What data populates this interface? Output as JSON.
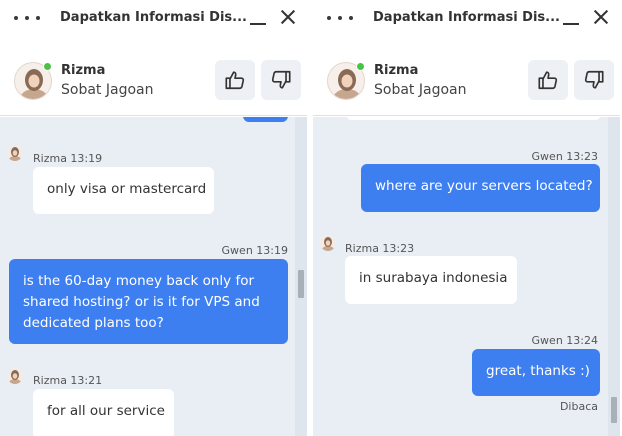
{
  "left": {
    "header": {
      "title": "Dapatkan Informasi Dis..."
    },
    "agent": {
      "name": "Rizma",
      "role": "Sobat Jagoan"
    },
    "messages": [
      {
        "meta": "Rizma 13:19",
        "text": "only visa or mastercard"
      },
      {
        "meta": "Gwen 13:19",
        "lines": [
          "is the 60-day money back only for",
          "shared hosting? or is it for VPS and",
          "dedicated plans too?"
        ]
      },
      {
        "meta": "Rizma 13:21",
        "text": "for all our service"
      }
    ]
  },
  "right": {
    "header": {
      "title": "Dapatkan Informasi Dis..."
    },
    "agent": {
      "name": "Rizma",
      "role": "Sobat Jagoan"
    },
    "messages": [
      {
        "meta": "Gwen 13:23",
        "text": "where are your servers located?"
      },
      {
        "meta": "Rizma 13:23",
        "text": "in surabaya indonesia"
      },
      {
        "meta": "Gwen 13:24",
        "text": "great, thanks :)"
      }
    ],
    "read_status": "Dibaca"
  },
  "colors": {
    "user_bubble": "#3d7ff0",
    "agent_bubble": "#ffffff",
    "chat_bg": "#e9eef5",
    "online": "#4cc245"
  },
  "icons": [
    "more-dots-icon",
    "minimize-icon",
    "close-icon",
    "thumbs-up-icon",
    "thumbs-down-icon"
  ]
}
